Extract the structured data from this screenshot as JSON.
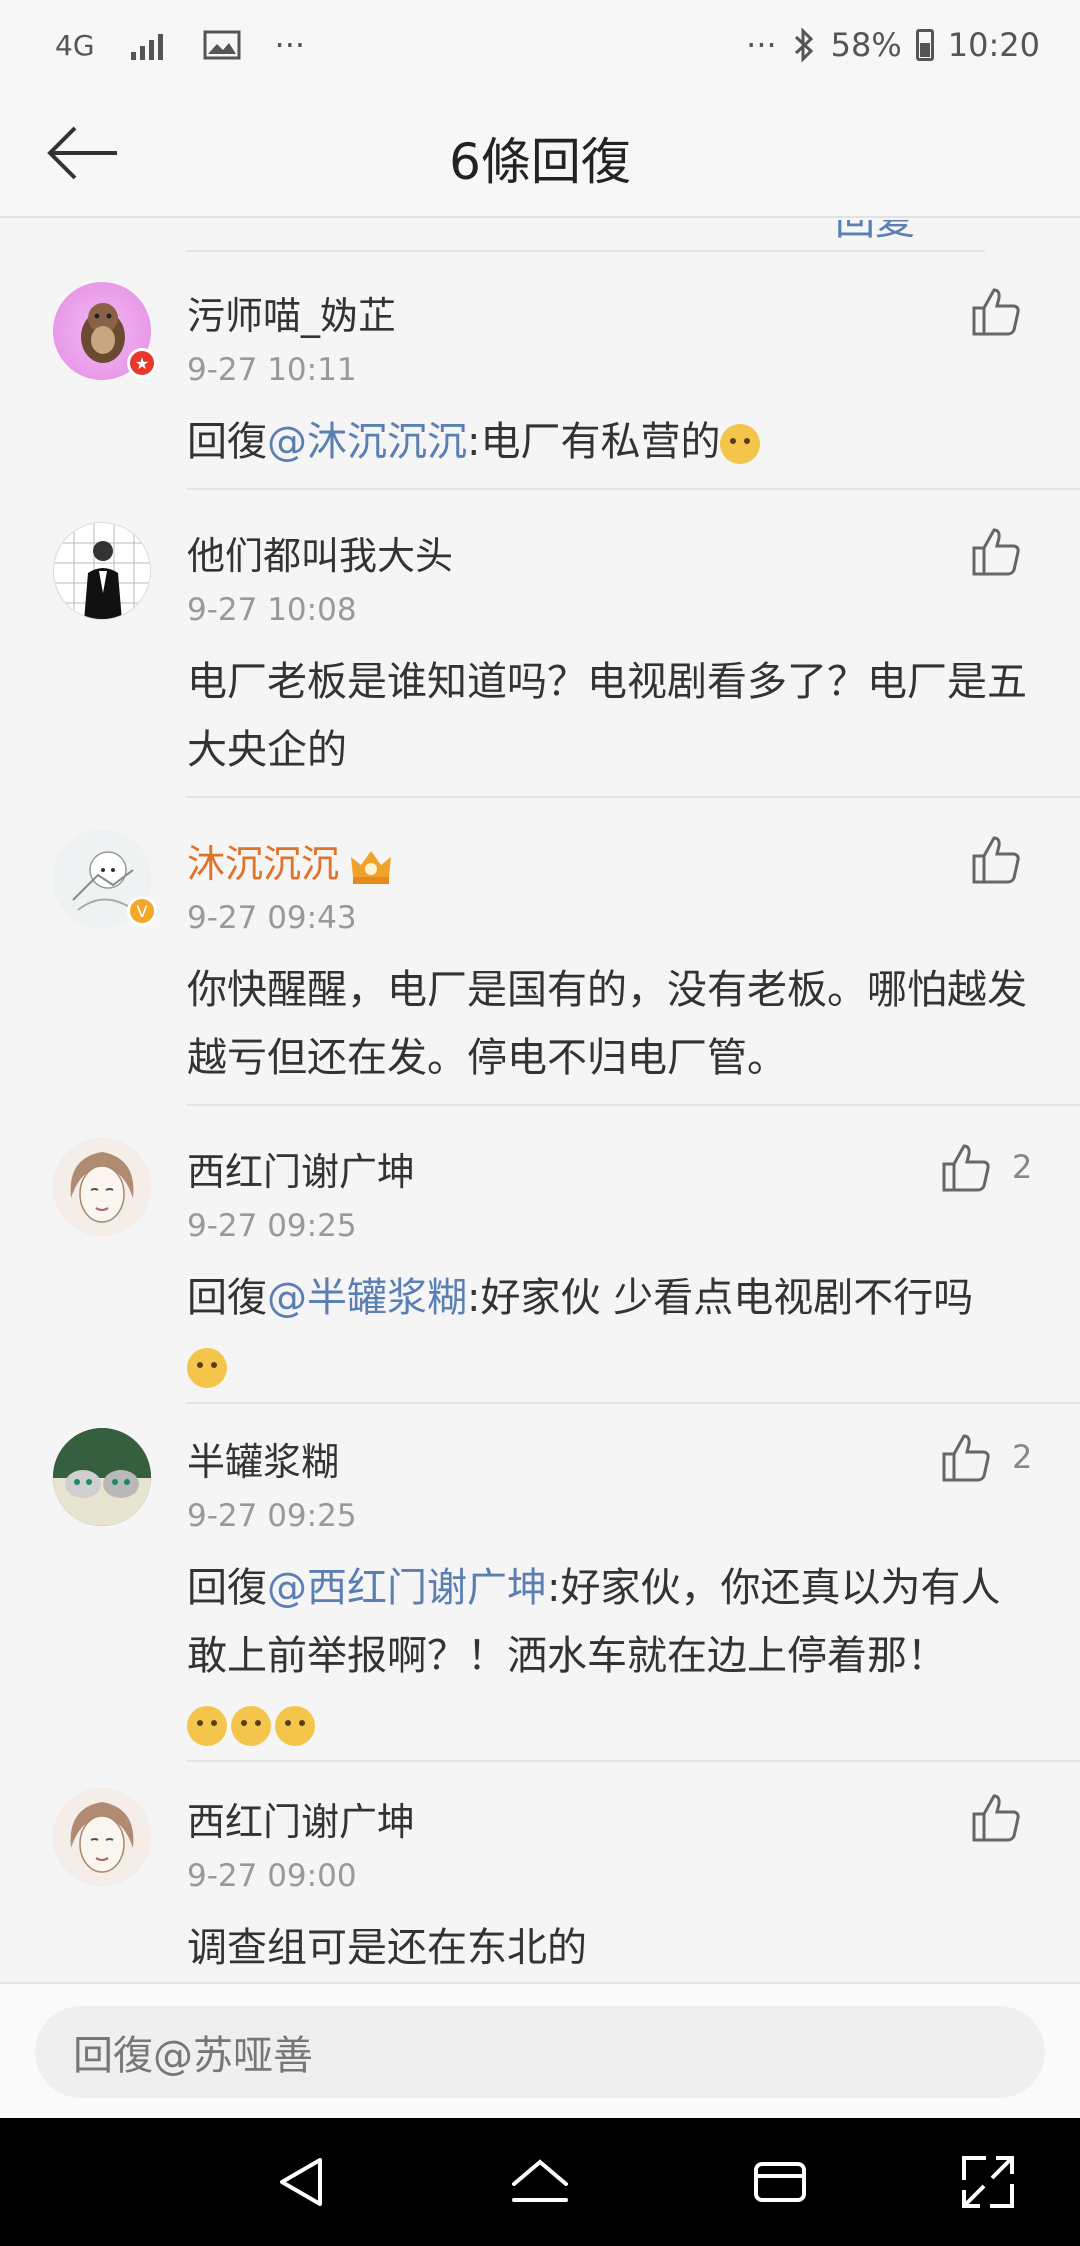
{
  "status_bar": {
    "network": "4G",
    "dots_left": "···",
    "dots_right": "···",
    "battery": "58%",
    "time": "10:20"
  },
  "header": {
    "title": "6條回復"
  },
  "partial_top_text": "回复",
  "comments": [
    {
      "name": "污师喵_妫芷",
      "time": "9-27 10:11",
      "prefix": "回復",
      "mention": "@沐沉沉沉",
      "text": ":电厂有私营的",
      "likes": ""
    },
    {
      "name": "他们都叫我大头",
      "time": "9-27 10:08",
      "prefix": "",
      "mention": "",
      "text": "电厂老板是谁知道吗？电视剧看多了？电厂是五大央企的",
      "likes": ""
    },
    {
      "name": "沐沉沉沉",
      "time": "9-27 09:43",
      "prefix": "",
      "mention": "",
      "text": "你快醒醒，电厂是国有的，没有老板。哪怕越发越亏但还在发。停电不归电厂管。",
      "likes": ""
    },
    {
      "name": "西红门谢广坤",
      "time": "9-27 09:25",
      "prefix": "回復",
      "mention": "@半罐浆糊",
      "text": ":好家伙 少看点电视剧不行吗",
      "likes": "2"
    },
    {
      "name": "半罐浆糊",
      "time": "9-27 09:25",
      "prefix": "回復",
      "mention": "@西红门谢广坤",
      "text": ":好家伙，你还真以为有人敢上前举报啊？！洒水车就在边上停着那！",
      "likes": "2"
    },
    {
      "name": "西红门谢广坤",
      "time": "9-27 09:00",
      "prefix": "",
      "mention": "",
      "text": "调查组可是还在东北的",
      "likes": ""
    }
  ],
  "reply_bar": {
    "placeholder": "回復@苏哑善"
  },
  "colors": {
    "mention": "#5b7fb3",
    "vip_name": "#e0722a",
    "background": "#f5f5f5"
  },
  "icons": {
    "back": "arrow-left-icon",
    "like": "thumbs-up-icon",
    "nav_back": "triangle-back-icon",
    "nav_home": "home-icon",
    "nav_recent": "recent-apps-icon",
    "nav_expand": "expand-icon"
  }
}
